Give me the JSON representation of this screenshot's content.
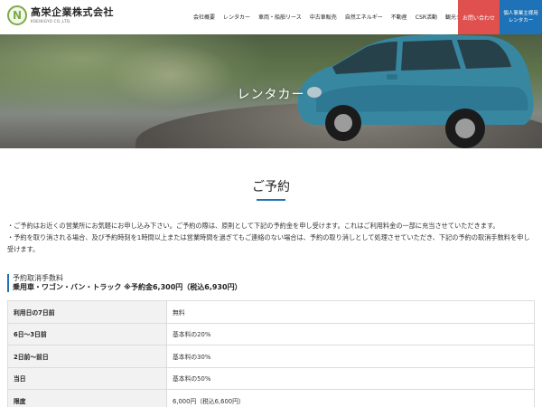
{
  "header": {
    "logo_mark": "N",
    "logo_name": "高栄企業株式会社",
    "logo_en": "KOEIKIGYO CO.,LTD.",
    "nav": [
      "会社概要",
      "レンタカー",
      "車両・船舶リース",
      "中古車販売",
      "自然エネルギー",
      "不動産",
      "CSR活動",
      "観光タウン情報"
    ],
    "contact_button": "お問い合わせ",
    "rental_button_line1": "個人事業主様用",
    "rental_button_line2": "レンタカー"
  },
  "hero": {
    "title": "レンタカー"
  },
  "section": {
    "title": "ご予約"
  },
  "notes": {
    "line1": "・ご予約はお近くの営業所にお気軽にお申し込み下さい。ご予約の際は、原則として下記の予約金を申し受けます。これはご利用料金の一部に充当させていただきます。",
    "line2": "・予約を取り消される場合、及び予約時刻を1時間以上または営業時間を過ぎてもご連絡のない場合は、予約の取り消しとして処理させていただき、下記の予約の取消手数料を申し受けます。"
  },
  "fee": {
    "title": "予約取消手数料",
    "subtitle": "乗用車・ワゴン・バン・トラック ※予約金6,300円（税込6,930円）",
    "rows": [
      {
        "label": "利用日の7日前",
        "value": "無料"
      },
      {
        "label": "6日〜3日前",
        "value": "基本料の20%"
      },
      {
        "label": "2日前〜前日",
        "value": "基本料の30%"
      },
      {
        "label": "当日",
        "value": "基本料の50%"
      },
      {
        "label": "限度",
        "value": "6,000円（税込6,600円）"
      }
    ]
  },
  "colors": {
    "accent_blue": "#1e73b8",
    "contact_red": "#e0504e",
    "logo_green": "#7cab47"
  }
}
